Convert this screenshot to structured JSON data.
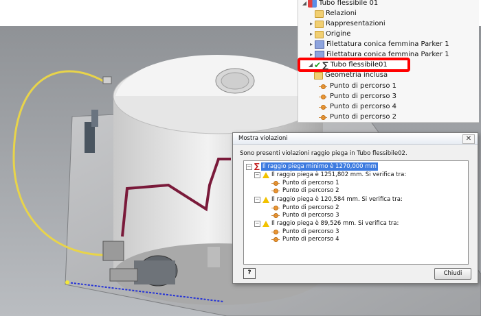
{
  "browser": {
    "items": [
      {
        "label": "Tubo flessibile 01",
        "icon": "assembly-icon"
      },
      {
        "label": "Relazioni",
        "icon": "folder-icon"
      },
      {
        "label": "Rappresentazioni",
        "icon": "folder-icon"
      },
      {
        "label": "Origine",
        "icon": "folder-icon"
      },
      {
        "label": "Filettatura conica femmina Parker 1",
        "icon": "fitting-icon"
      },
      {
        "label": "Filettatura conica femmina Parker 1",
        "icon": "fitting-icon"
      },
      {
        "label": "Tubo flessibile01",
        "icon": "hose-icon"
      },
      {
        "label": "Geometria inclusa",
        "icon": "folder-icon"
      },
      {
        "label": "Punto di percorso 1",
        "icon": "route-point-icon"
      },
      {
        "label": "Punto di percorso 3",
        "icon": "route-point-icon"
      },
      {
        "label": "Punto di percorso 4",
        "icon": "route-point-icon"
      },
      {
        "label": "Punto di percorso 2",
        "icon": "route-point-icon"
      }
    ]
  },
  "dialog": {
    "title": "Mostra violazioni",
    "message": "Sono presenti violazioni raggio piega in Tubo flessibile02.",
    "tree": {
      "root": "Il raggio piega minimo è 1270,000 mm",
      "violations": [
        {
          "text": "Il raggio piega è 1251,802 mm. Si verifica tra:",
          "points": [
            "Punto di percorso 1",
            "Punto di percorso 2"
          ]
        },
        {
          "text": "Il raggio piega è 120,584 mm. Si verifica tra:",
          "points": [
            "Punto di percorso 2",
            "Punto di percorso 3"
          ]
        },
        {
          "text": "Il raggio piega è 89,526 mm. Si verifica tra:",
          "points": [
            "Punto di percorso 3",
            "Punto di percorso 4"
          ]
        }
      ]
    },
    "help_label": "?",
    "close_label": "Chiudi"
  },
  "colors": {
    "highlight": "#ff0000",
    "hose": "#e8d44a",
    "pipe": "#7a1a3a",
    "selection": "#3d7be0"
  }
}
